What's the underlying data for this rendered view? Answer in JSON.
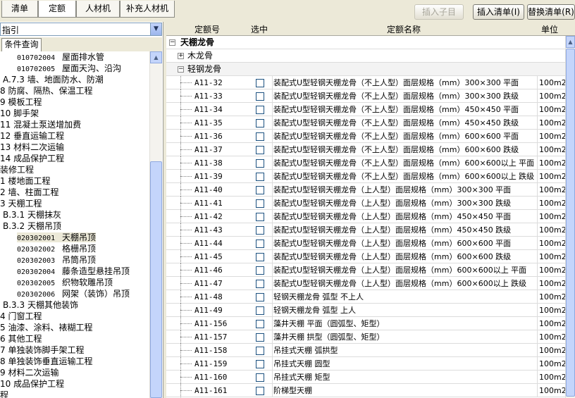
{
  "toolbar": {
    "tabs": [
      "清单",
      "定额",
      "人材机",
      "补充人材机"
    ],
    "insert_child": "插入子目",
    "insert_list": "插入清单(I)",
    "replace_list": "替换清单(R)"
  },
  "left_panel": {
    "combo_text": "指引",
    "tab_label": "条件查询",
    "tree": [
      {
        "code": "010702004",
        "label": "屋面排水管"
      },
      {
        "code": "010702005",
        "label": "屋面天沟、沿沟"
      },
      {
        "label": "A.7.3 墙、地面防水、防潮"
      },
      {
        "label": "8 防腐、隔热、保温工程"
      },
      {
        "label": "9 模板工程"
      },
      {
        "label": "10 脚手架"
      },
      {
        "label": "11 混凝土泵送增加费"
      },
      {
        "label": "12 垂直运输工程"
      },
      {
        "label": "13 材料二次运输"
      },
      {
        "label": "14 成品保护工程"
      },
      {
        "label": "装修工程"
      },
      {
        "label": "1 楼地面工程"
      },
      {
        "label": "2 墙、柱面工程"
      },
      {
        "label": "3 天棚工程"
      },
      {
        "label": "B.3.1 天棚抹灰"
      },
      {
        "label": "B.3.2 天棚吊顶"
      },
      {
        "code": "020302001",
        "label": "天棚吊顶"
      },
      {
        "code": "020302002",
        "label": "格栅吊顶"
      },
      {
        "code": "020302003",
        "label": "吊筒吊顶"
      },
      {
        "code": "020302004",
        "label": "藤条造型悬挂吊顶"
      },
      {
        "code": "020302005",
        "label": "织物软雕吊顶"
      },
      {
        "code": "020302006",
        "label": "网架（装饰）吊顶"
      },
      {
        "label": "B.3.3 天棚其他装饰"
      },
      {
        "label": "4 门窗工程"
      },
      {
        "label": "5 油漆、涂料、裱糊工程"
      },
      {
        "label": "6 其他工程"
      },
      {
        "label": "7 单独装饰脚手架工程"
      },
      {
        "label": "8 单独装饰垂直运输工程"
      },
      {
        "label": "9 材料二次运输"
      },
      {
        "label": "10 成品保护工程"
      },
      {
        "label": "程"
      }
    ]
  },
  "grid": {
    "headers": {
      "code": "定额号",
      "select": "选中",
      "name": "定额名称",
      "unit": "单位"
    },
    "group_label": "天棚龙骨",
    "sub_collapsed": "木龙骨",
    "sub_expanded": "轻钢龙骨",
    "rows": [
      {
        "code": "A11-32",
        "name": "装配式U型轻钢天棚龙骨（不上人型）面层规格（mm）300×300 平面",
        "unit": "100m2"
      },
      {
        "code": "A11-33",
        "name": "装配式U型轻钢天棚龙骨（不上人型）面层规格（mm）300×300 跌级",
        "unit": "100m2"
      },
      {
        "code": "A11-34",
        "name": "装配式U型轻钢天棚龙骨（不上人型）面层规格（mm）450×450 平面",
        "unit": "100m2"
      },
      {
        "code": "A11-35",
        "name": "装配式U型轻钢天棚龙骨（不上人型）面层规格（mm）450×450 跌级",
        "unit": "100m2"
      },
      {
        "code": "A11-36",
        "name": "装配式U型轻钢天棚龙骨（不上人型）面层规格（mm）600×600 平面",
        "unit": "100m2"
      },
      {
        "code": "A11-37",
        "name": "装配式U型轻钢天棚龙骨（不上人型）面层规格（mm）600×600 跌级",
        "unit": "100m2"
      },
      {
        "code": "A11-38",
        "name": "装配式U型轻钢天棚龙骨（不上人型）面层规格（mm）600×600以上 平面",
        "unit": "100m2"
      },
      {
        "code": "A11-39",
        "name": "装配式U型轻钢天棚龙骨（不上人型）面层规格（mm）600×600以上 跌级",
        "unit": "100m2"
      },
      {
        "code": "A11-40",
        "name": "装配式U型轻钢天棚龙骨（上人型）面层规格（mm）300×300 平面",
        "unit": "100m2"
      },
      {
        "code": "A11-41",
        "name": "装配式U型轻钢天棚龙骨（上人型）面层规格（mm）300×300 跌级",
        "unit": "100m2"
      },
      {
        "code": "A11-42",
        "name": "装配式U型轻钢天棚龙骨（上人型）面层规格（mm）450×450 平面",
        "unit": "100m2"
      },
      {
        "code": "A11-43",
        "name": "装配式U型轻钢天棚龙骨（上人型）面层规格（mm）450×450 跌级",
        "unit": "100m2"
      },
      {
        "code": "A11-44",
        "name": "装配式U型轻钢天棚龙骨（上人型）面层规格（mm）600×600 平面",
        "unit": "100m2"
      },
      {
        "code": "A11-45",
        "name": "装配式U型轻钢天棚龙骨（上人型）面层规格（mm）600×600 跌级",
        "unit": "100m2"
      },
      {
        "code": "A11-46",
        "name": "装配式U型轻钢天棚龙骨（上人型）面层规格（mm）600×600以上 平面",
        "unit": "100m2"
      },
      {
        "code": "A11-47",
        "name": "装配式U型轻钢天棚龙骨（上人型）面层规格（mm）600×600以上 跌级",
        "unit": "100m2"
      },
      {
        "code": "A11-48",
        "name": "轻钢天棚龙骨 弧型 不上人",
        "unit": "100m2"
      },
      {
        "code": "A11-49",
        "name": "轻钢天棚龙骨 弧型 上人",
        "unit": "100m2"
      },
      {
        "code": "A11-156",
        "name": "藻井天棚 平面（圆弧型、矩型）",
        "unit": "100m2"
      },
      {
        "code": "A11-157",
        "name": "藻井天棚 拱型（圆弧型、矩型）",
        "unit": "100m2"
      },
      {
        "code": "A11-158",
        "name": "吊挂式天棚 弧拱型",
        "unit": "100m2"
      },
      {
        "code": "A11-159",
        "name": "吊挂式天棚 圆型",
        "unit": "100m2"
      },
      {
        "code": "A11-160",
        "name": "吊挂式天棚 矩型",
        "unit": "100m2"
      },
      {
        "code": "A11-161",
        "name": "阶梯型天棚",
        "unit": "100m2"
      }
    ]
  }
}
